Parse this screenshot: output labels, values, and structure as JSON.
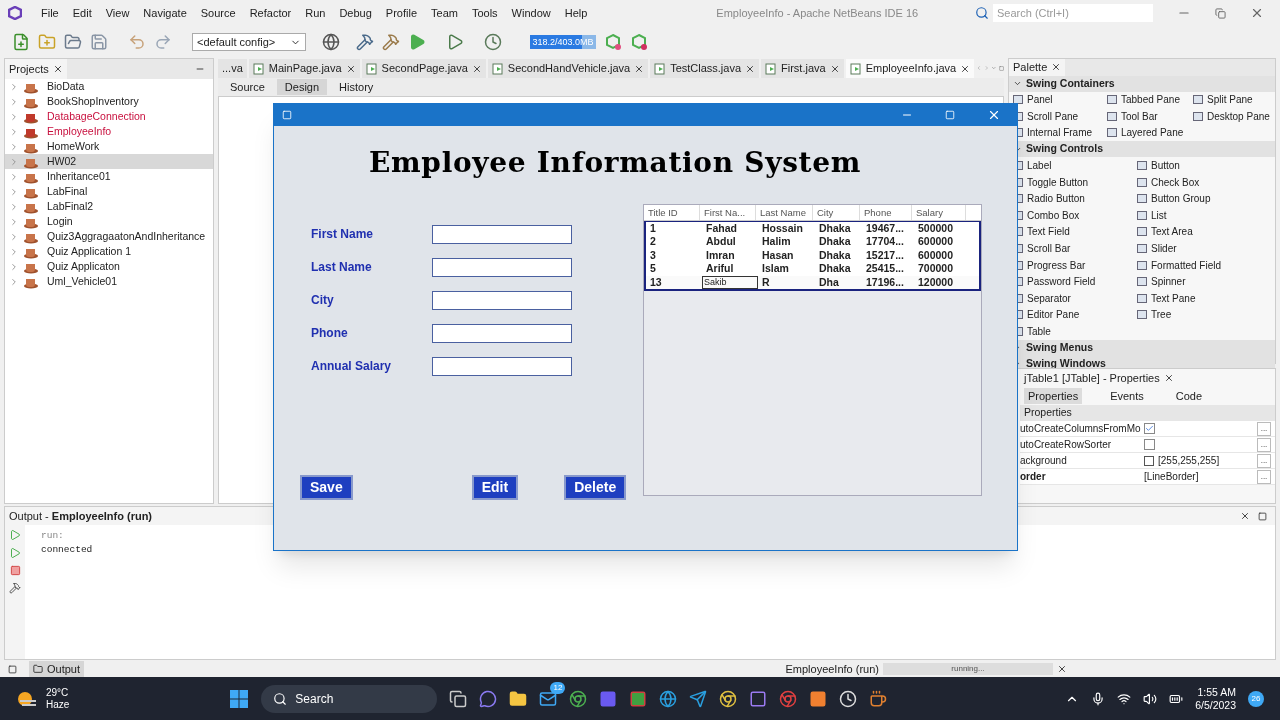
{
  "menu": [
    "File",
    "Edit",
    "View",
    "Navigate",
    "Source",
    "Refactor",
    "Run",
    "Debug",
    "Profile",
    "Team",
    "Tools",
    "Window",
    "Help"
  ],
  "window": {
    "title": "EmployeeInfo - Apache NetBeans IDE 16"
  },
  "search": {
    "placeholder": "Search (Ctrl+I)"
  },
  "toolbar": {
    "config": "<default config>",
    "memory": {
      "reading": "318.2/403.0MB",
      "level": 0.79
    }
  },
  "projects": {
    "title": "Projects",
    "items": [
      {
        "name": "BioData",
        "selected": false,
        "error": false
      },
      {
        "name": "BookShopInventory",
        "selected": false,
        "error": false
      },
      {
        "name": "DatabageConnection",
        "selected": false,
        "error": true
      },
      {
        "name": "EmployeeInfo",
        "selected": false,
        "error": true
      },
      {
        "name": "HomeWork",
        "selected": false,
        "error": false
      },
      {
        "name": "HW02",
        "selected": true,
        "error": false
      },
      {
        "name": "Inheritance01",
        "selected": false,
        "error": false
      },
      {
        "name": "LabFinal",
        "selected": false,
        "error": false
      },
      {
        "name": "LabFinal2",
        "selected": false,
        "error": false
      },
      {
        "name": "Login",
        "selected": false,
        "error": false
      },
      {
        "name": "Quiz3AggragaatonAndInheritance",
        "selected": false,
        "error": false
      },
      {
        "name": "Quiz Application 1",
        "selected": false,
        "error": false
      },
      {
        "name": "Quiz Applicaton",
        "selected": false,
        "error": false
      },
      {
        "name": "Uml_Vehicle01",
        "selected": false,
        "error": false
      }
    ]
  },
  "editor_tabs": [
    {
      "label": "...va",
      "selected": false
    },
    {
      "label": "MainPage.java",
      "selected": false
    },
    {
      "label": "SecondPage.java",
      "selected": false
    },
    {
      "label": "SecondHandVehicle.java",
      "selected": false
    },
    {
      "label": "TestClass.java",
      "selected": false
    },
    {
      "label": "First.java",
      "selected": false
    },
    {
      "label": "EmployeeInfo.java",
      "selected": true
    }
  ],
  "view_tabs": [
    {
      "label": "Source",
      "selected": false
    },
    {
      "label": "Design",
      "selected": true
    },
    {
      "label": "History",
      "selected": false
    }
  ],
  "palette": {
    "title": "Palette",
    "sections": [
      {
        "name": "Swing Containers",
        "expanded": true,
        "items": [
          "Panel",
          "Tabbed Pane",
          "Split Pane",
          "Scroll Pane",
          "Tool Bar",
          "Desktop Pane",
          "Internal Frame",
          "Layered Pane"
        ]
      },
      {
        "name": "Swing Controls",
        "expanded": true,
        "items": [
          "Label",
          "Button",
          "Toggle Button",
          "Check Box",
          "Radio Button",
          "Button Group",
          "Combo Box",
          "List",
          "Text Field",
          "Text Area",
          "Scroll Bar",
          "Slider",
          "Progress Bar",
          "Formatted Field",
          "Password Field",
          "Spinner",
          "Separator",
          "Text Pane",
          "Editor Pane",
          "Tree",
          "Table"
        ]
      },
      {
        "name": "Swing Menus",
        "expanded": false
      },
      {
        "name": "Swing Windows",
        "expanded": false
      }
    ]
  },
  "properties": {
    "title": "jTable1 [JTable] - Properties",
    "tabs": [
      {
        "label": "Properties",
        "selected": true
      },
      {
        "label": "Events",
        "selected": false
      },
      {
        "label": "Code",
        "selected": false
      }
    ],
    "group": "Properties",
    "rows": [
      {
        "name": "utoCreateColumnsFromMo",
        "kind": "checkbox",
        "checked": true,
        "modified": false,
        "more": "..."
      },
      {
        "name": "utoCreateRowSorter",
        "kind": "checkbox",
        "checked": false,
        "modified": false,
        "more": "..."
      },
      {
        "name": "ackground",
        "kind": "color",
        "value": "[255,255,255]",
        "modified": false,
        "more": "..."
      },
      {
        "name": "order",
        "kind": "text",
        "value": "[LineBorder]",
        "modified": true,
        "more": "..."
      }
    ]
  },
  "output": {
    "title": "Output - ",
    "run_name": "EmployeeInfo (run)",
    "lines": [
      {
        "text": "run:",
        "kind": "meta"
      },
      {
        "text": "connected",
        "kind": "plain"
      }
    ],
    "tab": "Output"
  },
  "status": {
    "task": "EmployeeInfo (run)",
    "progress": "running...",
    "level": 1
  },
  "dialog": {
    "heading": "Employee Information System",
    "fields": [
      {
        "label": "First Name"
      },
      {
        "label": "Last Name"
      },
      {
        "label": "City"
      },
      {
        "label": "Phone"
      },
      {
        "label": "Annual Salary"
      }
    ],
    "table": {
      "columns": [
        "Title ID",
        "First Na...",
        "Last Name",
        "City",
        "Phone",
        "Salary"
      ],
      "rows": [
        {
          "cells": [
            "1",
            "Fahad",
            "Hossain",
            "Dhaka",
            "19467...",
            "500000"
          ],
          "editing": false
        },
        {
          "cells": [
            "2",
            "Abdul",
            "Halim",
            "Dhaka",
            "17704...",
            "600000"
          ],
          "editing": false
        },
        {
          "cells": [
            "3",
            "Imran",
            "Hasan",
            "Dhaka",
            "15217...",
            "600000"
          ],
          "editing": false
        },
        {
          "cells": [
            "5",
            "Ariful",
            "Islam",
            "Dhaka",
            "25415...",
            "700000"
          ],
          "editing": false
        },
        {
          "cells": [
            "13",
            "Sakib",
            "R",
            "Dha",
            "17196...",
            "120000"
          ],
          "editing": true
        }
      ]
    },
    "buttons": [
      "Save",
      "Edit",
      "Delete"
    ]
  },
  "taskbar": {
    "temperature": "29°C",
    "weather": "Haze",
    "search": "Search",
    "mail_badge": "12",
    "time": "1:55 AM",
    "date": "6/5/2023",
    "notifications": "26"
  }
}
